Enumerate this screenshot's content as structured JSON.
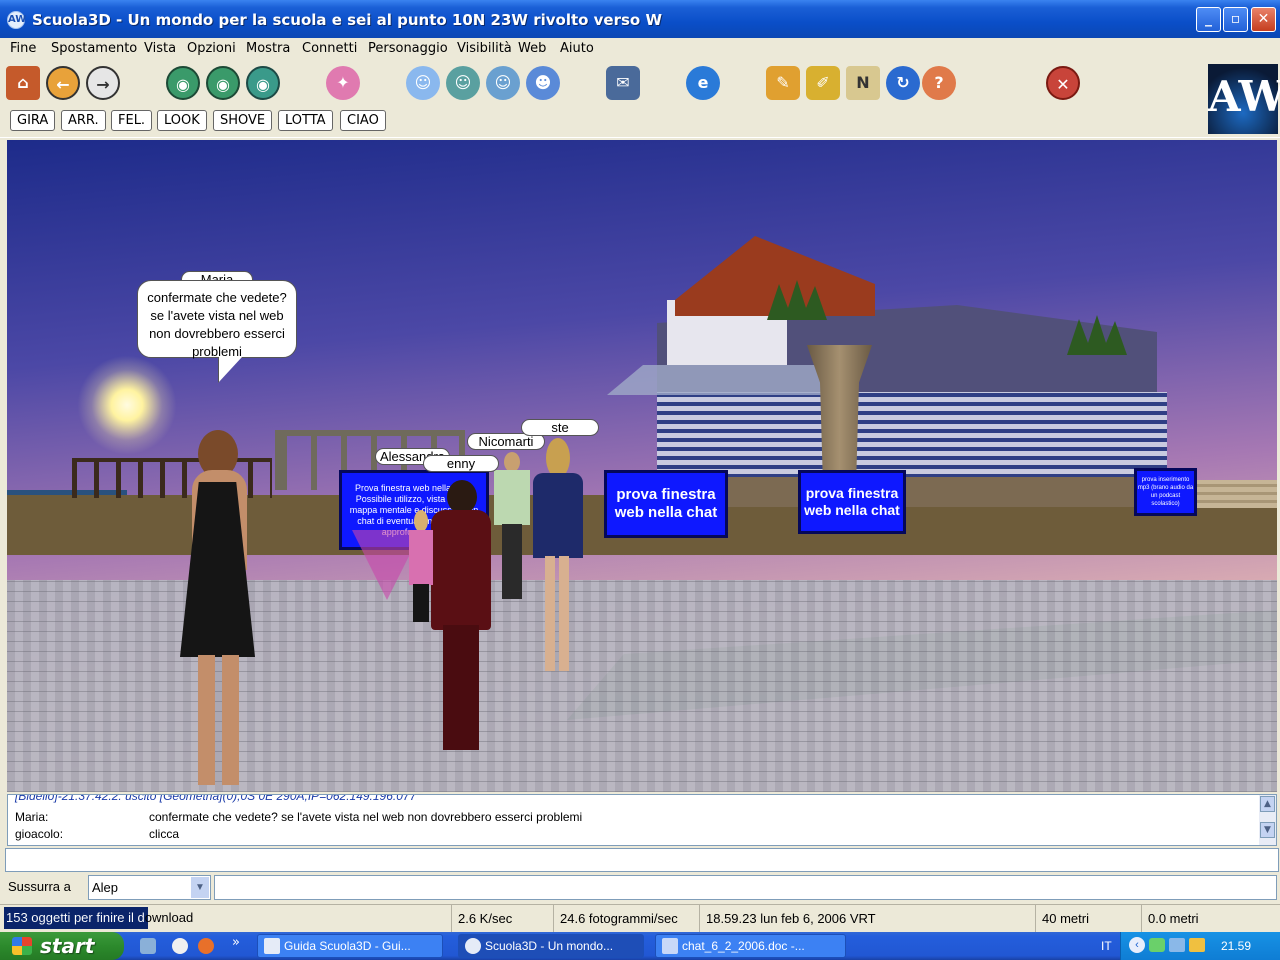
{
  "window": {
    "title": "Scuola3D - Un mondo per la scuola e sei al punto 10N 23W rivolto verso W",
    "app_icon": "AW",
    "controls": [
      "minimize",
      "maximize",
      "close"
    ]
  },
  "menu": {
    "items": [
      "Fine",
      "Spostamento",
      "Vista",
      "Opzioni",
      "Mostra",
      "Connetti",
      "Personaggio",
      "Visibilità",
      "Web",
      "Aiuto"
    ]
  },
  "toolbar": {
    "icons": [
      "home-icon",
      "back-icon",
      "forward-icon",
      "view-first-person-icon",
      "view-behind-icon",
      "view-front-icon",
      "teleport-icon",
      "avatar-icon",
      "user-icon",
      "contacts-icon",
      "group-icon",
      "telegram-icon",
      "browser-icon",
      "tool-icon",
      "edit-icon",
      "note-icon",
      "refresh-icon",
      "help-icon",
      "stop-icon"
    ],
    "brand_logo": "AW"
  },
  "gestures": [
    "GIRA",
    "ARR.",
    "FEL.",
    "LOOK",
    "SHOVE",
    "LOTTA",
    "CIAO"
  ],
  "scene": {
    "speech_bubble": {
      "name": "Maria",
      "lines": [
        "confermate che vedete?",
        "se l'avete vista nel web",
        "non dovrebbero esserci",
        "problemi"
      ]
    },
    "name_tags": [
      "Alessandra",
      "enny",
      "Nicomarti",
      "ste"
    ],
    "screens": [
      {
        "text": "Prova finestra web nella chat. Possibile utilizzo, vista di una mappa mentale e discussione in chat di eventuali modifiche e approfondimenti"
      },
      {
        "text": "prova finestra web nella chat"
      },
      {
        "text": "prova finestra web nella chat"
      },
      {
        "text": "prova inserimento mp3 (brano audio da un podcast scolastico)"
      }
    ]
  },
  "chat": {
    "partial_line": "[Bidello]-21.37.42.2: uscito [Geometria](0),0S 0E 290A,IP=062.149.196.077",
    "lines": [
      {
        "who": "Maria:",
        "text": "confermate che vedete? se l'avete vista nel web non dovrebbero esserci problemi"
      },
      {
        "who": "gioacolo:",
        "text": "clicca"
      }
    ],
    "input_value": ""
  },
  "whisper": {
    "label": "Sussurra a",
    "selected": "Alep",
    "input_value": ""
  },
  "status": {
    "download_text": "153 oggetti per finire il download",
    "download_progress": 0.1,
    "rate": "2.6 K/sec",
    "fps": "24.6 fotogrammi/sec",
    "datetime": "18.59.23 lun feb 6, 2006 VRT",
    "visibility": "40 metri",
    "altitude": "0.0 metri"
  },
  "taskbar": {
    "start_label": "start",
    "chevron": "»",
    "tasks": [
      {
        "label": "Guida Scuola3D - Gui...",
        "active": false
      },
      {
        "label": "Scuola3D - Un mondo...",
        "active": true
      },
      {
        "label": "chat_6_2_2006.doc -...",
        "active": false
      }
    ],
    "language": "IT",
    "clock": "21.59"
  },
  "colors": {
    "titlebar": "#0a4ec8",
    "screen_blue": "#0e18ff",
    "progress": "#0a246a",
    "start_green": "#2c8a2c"
  }
}
